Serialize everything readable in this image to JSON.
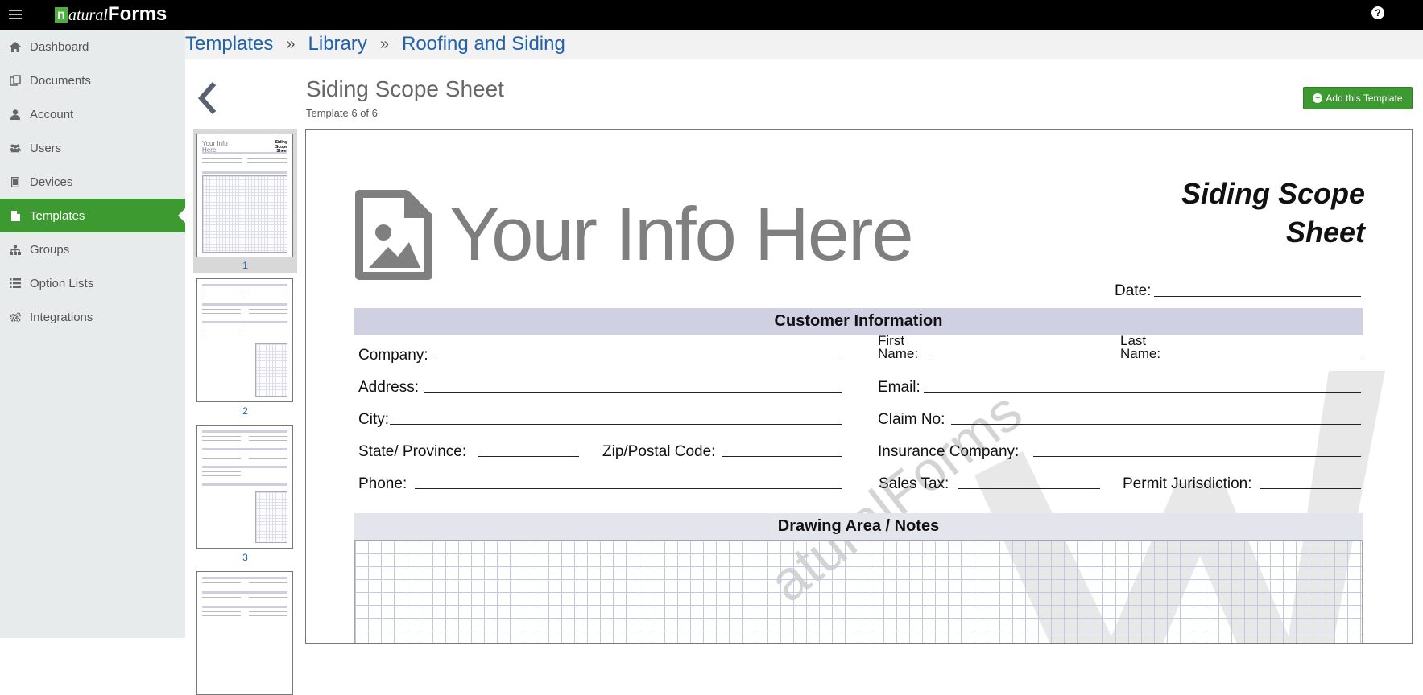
{
  "app": {
    "logo_letter": "n",
    "logo_natural": "atural",
    "logo_forms": "Forms",
    "help_glyph": "?"
  },
  "sidebar": {
    "items": [
      {
        "label": "Dashboard",
        "icon": "home-icon"
      },
      {
        "label": "Documents",
        "icon": "documents-icon"
      },
      {
        "label": "Account",
        "icon": "user-icon"
      },
      {
        "label": "Users",
        "icon": "users-icon"
      },
      {
        "label": "Devices",
        "icon": "tablet-icon"
      },
      {
        "label": "Templates",
        "icon": "file-icon",
        "active": true
      },
      {
        "label": "Groups",
        "icon": "sitemap-icon"
      },
      {
        "label": "Option Lists",
        "icon": "list-icon"
      },
      {
        "label": "Integrations",
        "icon": "cogs-icon"
      }
    ]
  },
  "breadcrumb": {
    "items": [
      "Templates",
      "Library",
      "Roofing and Siding"
    ],
    "separator": "»"
  },
  "template": {
    "title": "Siding Scope Sheet",
    "subtitle": "Template 6 of 6",
    "add_button": "Add this Template"
  },
  "thumbnails": {
    "pages": [
      "1",
      "2",
      "3"
    ],
    "thumb_header": "Your Info Here",
    "thumb_title": "Siding Scope Sheet"
  },
  "document": {
    "placeholder_text": "Your Info Here",
    "title_line1": "Siding Scope",
    "title_line2": "Sheet",
    "date_label": "Date:",
    "section_customer": "Customer Information",
    "section_drawing": "Drawing Area / Notes",
    "fields": {
      "company": "Company:",
      "first_name_1": "First",
      "first_name_2": "Name:",
      "last_name_1": "Last",
      "last_name_2": "Name:",
      "address": "Address:",
      "email": "Email:",
      "city": "City:",
      "claim_no": "Claim No:",
      "state": "State/ Province:",
      "zip": "Zip/Postal Code:",
      "insurance": "Insurance Company:",
      "phone": "Phone:",
      "sales_tax": "Sales Tax:",
      "permit": "Permit Jurisdiction:"
    },
    "watermark": "aturalForms"
  },
  "colors": {
    "accent_green": "#3d9a31",
    "link_blue": "#2262a8",
    "section_bar": "#cfd0e2"
  }
}
